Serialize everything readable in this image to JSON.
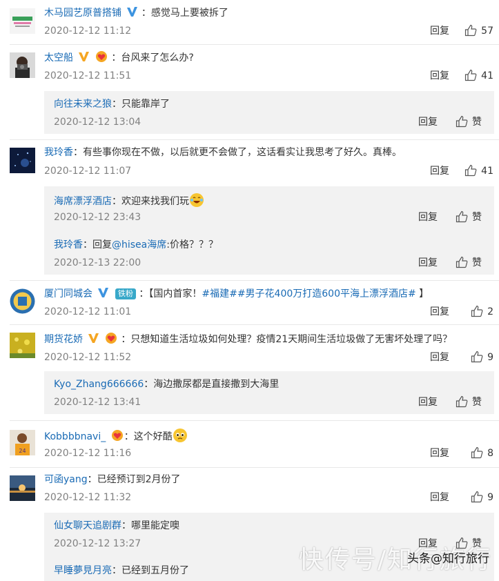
{
  "labels": {
    "reply": "回复",
    "like": "赞"
  },
  "comments": [
    {
      "user": "木马园艺原普搭铺",
      "sep": "：",
      "text": "感觉马上要被拆了",
      "time": "2020-12-12 11:12",
      "likes": "57"
    },
    {
      "user": "太空船",
      "sep": "：",
      "text": "台风来了怎么办?",
      "time": "2020-12-12 11:51",
      "likes": "41",
      "replies": [
        {
          "user": "向往未来之狼",
          "sep": "：",
          "text": "只能靠岸了",
          "time": "2020-12-12 13:04"
        }
      ]
    },
    {
      "user": "我玲香",
      "sep": "：",
      "text": "有些事你现在不做，以后就更不会做了，这话看实让我思考了好久。真棒。",
      "time": "2020-12-12 11:07",
      "likes": "41",
      "replies": [
        {
          "user": "海席漂浮酒店",
          "sep": "：",
          "text": "欢迎来找我们玩",
          "time": "2020-12-12 23:43"
        },
        {
          "user": "我玲香",
          "sep": "：",
          "text_pre": "回复",
          "mention": "@hisea海席",
          "text": ":价格？？？",
          "time": "2020-12-13 22:00"
        }
      ]
    },
    {
      "user": "厦门同城会",
      "fan_badge": "铁粉",
      "sep": "：",
      "text_pre": "【国内首家！",
      "topic": "#福建##男子花400万打造600平海上漂浮酒店#",
      "text": " 】",
      "time": "2020-12-12 11:01",
      "likes": "2"
    },
    {
      "user": "期货花娇",
      "sep": "：",
      "text": "只想知道生活垃圾如何处理？疫情21天期间生活垃圾做了无害坏处理了吗？",
      "time": "2020-12-12 11:52",
      "likes": "9",
      "replies": [
        {
          "user": "Kyo_Zhang666666",
          "sep": "：",
          "text": "海边撒尿都是直接撒到大海里",
          "time": "2020-12-12 13:41"
        }
      ]
    },
    {
      "user": "Kobbbbnavi_",
      "sep": "：",
      "text": "这个好酷",
      "time": "2020-12-12 11:16",
      "likes": "8"
    },
    {
      "user": "可函yang",
      "sep": "：",
      "text": "已经预订到2月份了",
      "time": "2020-12-12 11:32",
      "likes": "9",
      "replies": [
        {
          "user": "仙女聊天追剧群",
          "sep": "：",
          "text": "哪里能定噢",
          "time": "2020-12-12 13:27"
        },
        {
          "user": "早睡夢見月亮",
          "sep": "：",
          "text": "已经到五月份了"
        }
      ]
    }
  ],
  "watermark": {
    "large": "快传号/知行旅行",
    "small": "头条@知行旅行"
  },
  "colors": {
    "link": "#1a6bb5",
    "meta": "#808080",
    "subbox": "#f2f2f2",
    "badge_v": "#3d94e0",
    "badge_heart": "#f5a623"
  }
}
